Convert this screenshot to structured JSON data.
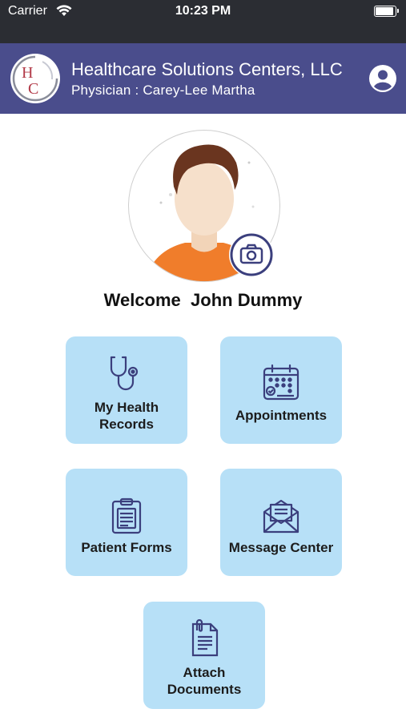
{
  "status_bar": {
    "carrier": "Carrier",
    "time": "10:23 PM"
  },
  "header": {
    "title": "Healthcare Solutions Centers, LLC",
    "subtitle": "Physician : Carey-Lee Martha",
    "logo_letters": "HC"
  },
  "welcome": {
    "prefix": "Welcome",
    "name": "John Dummy"
  },
  "tiles": [
    {
      "line1": "My Health",
      "line2": "Records",
      "icon": "stethoscope-icon"
    },
    {
      "line1": "Appointments",
      "line2": "",
      "icon": "calendar-icon"
    },
    {
      "line1": "Patient Forms",
      "line2": "",
      "icon": "clipboard-icon"
    },
    {
      "line1": "Message Center",
      "line2": "",
      "icon": "envelope-icon"
    },
    {
      "line1": "Attach",
      "line2": "Documents",
      "icon": "attach-document-icon"
    }
  ],
  "colors": {
    "header_bg": "#4a4d8c",
    "tile_bg": "#b7e0f7",
    "icon_color": "#3b3f7d",
    "status_bar_bg": "#2b2d33"
  }
}
